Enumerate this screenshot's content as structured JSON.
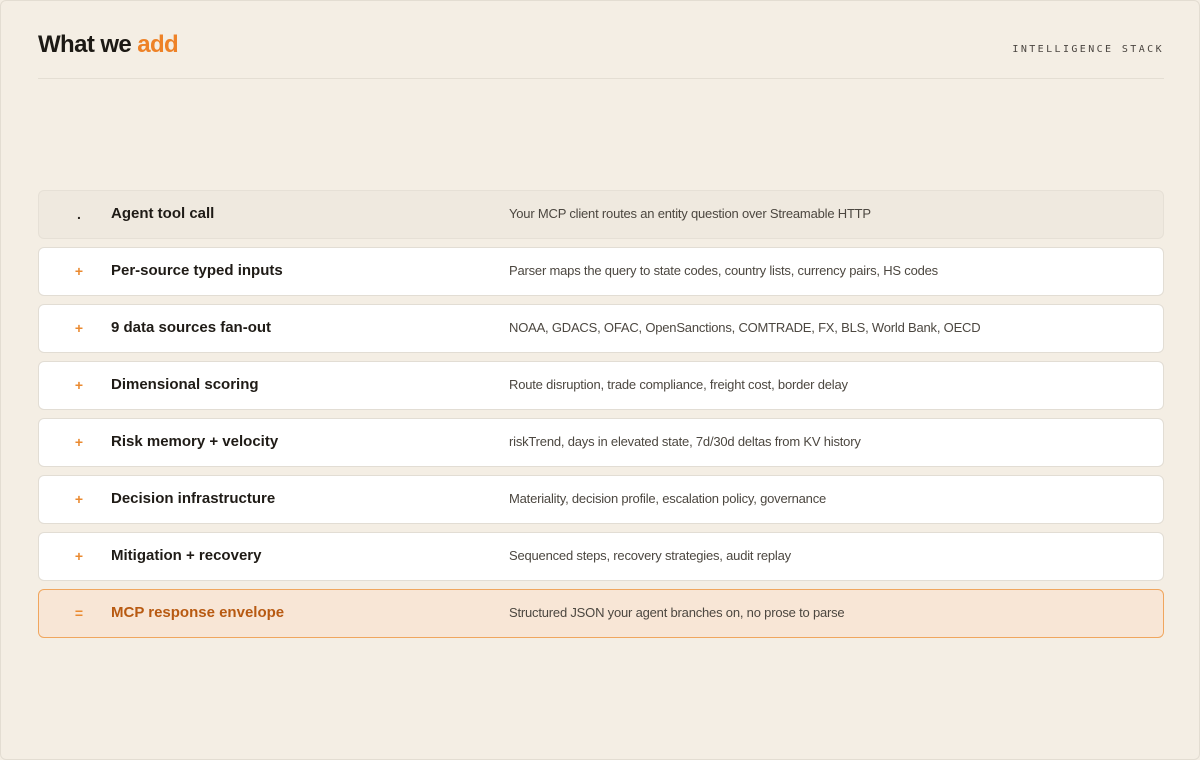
{
  "header": {
    "title_main": "What we ",
    "title_accent": "add",
    "kicker": "INTELLIGENCE STACK"
  },
  "colors": {
    "background": "#f4eee4",
    "accent": "#ee8227",
    "final_text": "#b85a12"
  },
  "steps": [
    {
      "symbol": ".",
      "title": "Agent tool call",
      "description": "Your MCP client routes an entity question over Streamable HTTP",
      "variant": "muted"
    },
    {
      "symbol": "+",
      "title": "Per-source typed inputs",
      "description": "Parser maps the query to state codes, country lists, currency pairs, HS codes",
      "variant": "default"
    },
    {
      "symbol": "+",
      "title": "9 data sources fan-out",
      "description": "NOAA, GDACS, OFAC, OpenSanctions, COMTRADE, FX, BLS, World Bank, OECD",
      "variant": "default"
    },
    {
      "symbol": "+",
      "title": "Dimensional scoring",
      "description": "Route disruption, trade compliance, freight cost, border delay",
      "variant": "default"
    },
    {
      "symbol": "+",
      "title": "Risk memory + velocity",
      "description": "riskTrend, days in elevated state, 7d/30d deltas from KV history",
      "variant": "default"
    },
    {
      "symbol": "+",
      "title": "Decision infrastructure",
      "description": "Materiality, decision profile, escalation policy, governance",
      "variant": "default"
    },
    {
      "symbol": "+",
      "title": "Mitigation + recovery",
      "description": "Sequenced steps, recovery strategies, audit replay",
      "variant": "default"
    },
    {
      "symbol": "=",
      "title": "MCP response envelope",
      "description": "Structured JSON your agent branches on, no prose to parse",
      "variant": "final"
    }
  ]
}
